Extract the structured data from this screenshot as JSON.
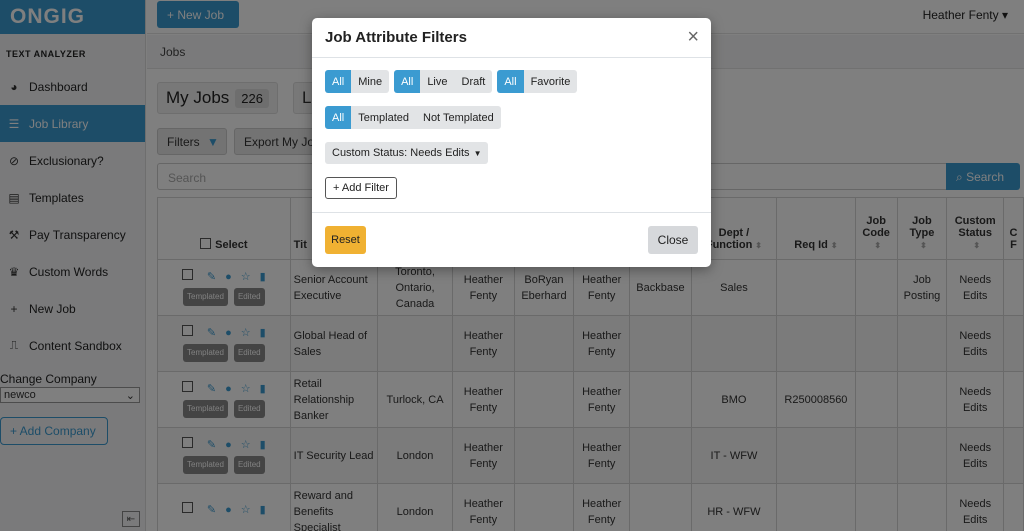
{
  "app": {
    "logo": "ONGIG",
    "new_job_label": "+ New Job",
    "user_name": "Heather Fenty ▾",
    "breadcrumb": "Jobs"
  },
  "sidebar": {
    "heading": "TEXT ANALYZER",
    "items": [
      {
        "label": "Dashboard",
        "icon": "◕",
        "icon_name": "dashboard-icon",
        "active": false
      },
      {
        "label": "Job Library",
        "icon": "☰",
        "icon_name": "list-icon",
        "active": true
      },
      {
        "label": "Exclusionary?",
        "icon": "⊘",
        "icon_name": "ban-icon",
        "active": false
      },
      {
        "label": "Templates",
        "icon": "▤",
        "icon_name": "document-icon",
        "active": false
      },
      {
        "label": "Pay Transparency",
        "icon": "⚒",
        "icon_name": "gavel-icon",
        "active": false
      },
      {
        "label": "Custom Words",
        "icon": "♛",
        "icon_name": "trophy-icon",
        "active": false
      },
      {
        "label": "New Job",
        "icon": "+",
        "icon_name": "plus-icon",
        "active": false
      },
      {
        "label": "Content Sandbox",
        "icon": "⎍",
        "icon_name": "sandbox-icon",
        "active": false
      }
    ],
    "change_company_label": "Change Company",
    "company_value": "newco",
    "add_company_label": "+ Add Company",
    "collapse_icon": "⇤"
  },
  "toolbar": {
    "my_jobs_label": "My Jobs",
    "my_jobs_count": "226",
    "library_tab_label": "L",
    "filters_label": "Filters",
    "export_label": "Export My Jobs",
    "search_placeholder": "Search",
    "search_button": "Search"
  },
  "table": {
    "select_label": "Select",
    "headers": [
      "Tit",
      "",
      "",
      "",
      "",
      "",
      "Dept / Function",
      "Req Id",
      "Job Code",
      "Job Type",
      "Custom Status",
      "C F"
    ],
    "tag_templated": "Templated",
    "tag_edited": "Edited",
    "rows": [
      {
        "title": "Senior Account Executive",
        "location": "Toronto, Ontario, Canada",
        "c3": "Heather Fenty",
        "c4": "BoRyan Eberhard",
        "c5": "Heather Fenty",
        "c6": "Backbase",
        "dept": "Sales",
        "req": "",
        "code": "",
        "type": "Job Posting",
        "status": "Needs Edits",
        "tags": true
      },
      {
        "title": "Global Head of Sales",
        "location": "",
        "c3": "Heather Fenty",
        "c4": "",
        "c5": "Heather Fenty",
        "c6": "",
        "dept": "",
        "req": "",
        "code": "",
        "type": "",
        "status": "Needs Edits",
        "tags": true
      },
      {
        "title": "Retail Relationship Banker",
        "location": "Turlock, CA",
        "c3": "Heather Fenty",
        "c4": "",
        "c5": "Heather Fenty",
        "c6": "",
        "dept": "BMO",
        "req": "R250008560",
        "code": "",
        "type": "",
        "status": "Needs Edits",
        "tags": true
      },
      {
        "title": "IT Security Lead",
        "location": "London",
        "c3": "Heather Fenty",
        "c4": "",
        "c5": "Heather Fenty",
        "c6": "",
        "dept": "IT - WFW",
        "req": "",
        "code": "",
        "type": "",
        "status": "Needs Edits",
        "tags": true
      },
      {
        "title": "Reward and Benefits Specialist",
        "location": "London",
        "c3": "Heather Fenty",
        "c4": "",
        "c5": "Heather Fenty",
        "c6": "",
        "dept": "HR - WFW",
        "req": "",
        "code": "",
        "type": "",
        "status": "Needs Edits",
        "tags": false
      }
    ]
  },
  "modal": {
    "title": "Job Attribute Filters",
    "close_icon": "×",
    "owner_group": [
      {
        "label": "All",
        "on": true
      },
      {
        "label": "Mine",
        "on": false
      }
    ],
    "status_group": [
      {
        "label": "All",
        "on": true
      },
      {
        "label": "Live",
        "on": false
      },
      {
        "label": "Draft",
        "on": false
      }
    ],
    "favorite_group": [
      {
        "label": "All",
        "on": true
      },
      {
        "label": "Favorite",
        "on": false
      }
    ],
    "template_group": [
      {
        "label": "All",
        "on": true
      },
      {
        "label": "Templated",
        "on": false
      },
      {
        "label": "Not Templated",
        "on": false
      }
    ],
    "custom_status_dropdown": "Custom Status: Needs Edits",
    "add_filter_label": "+ Add Filter",
    "reset_label": "Reset",
    "close_label": "Close"
  },
  "colors": {
    "brand_blue": "#3b9bd1",
    "reset_yellow": "#f0b132",
    "overlay": "rgba(0,0,0,0.5)"
  }
}
